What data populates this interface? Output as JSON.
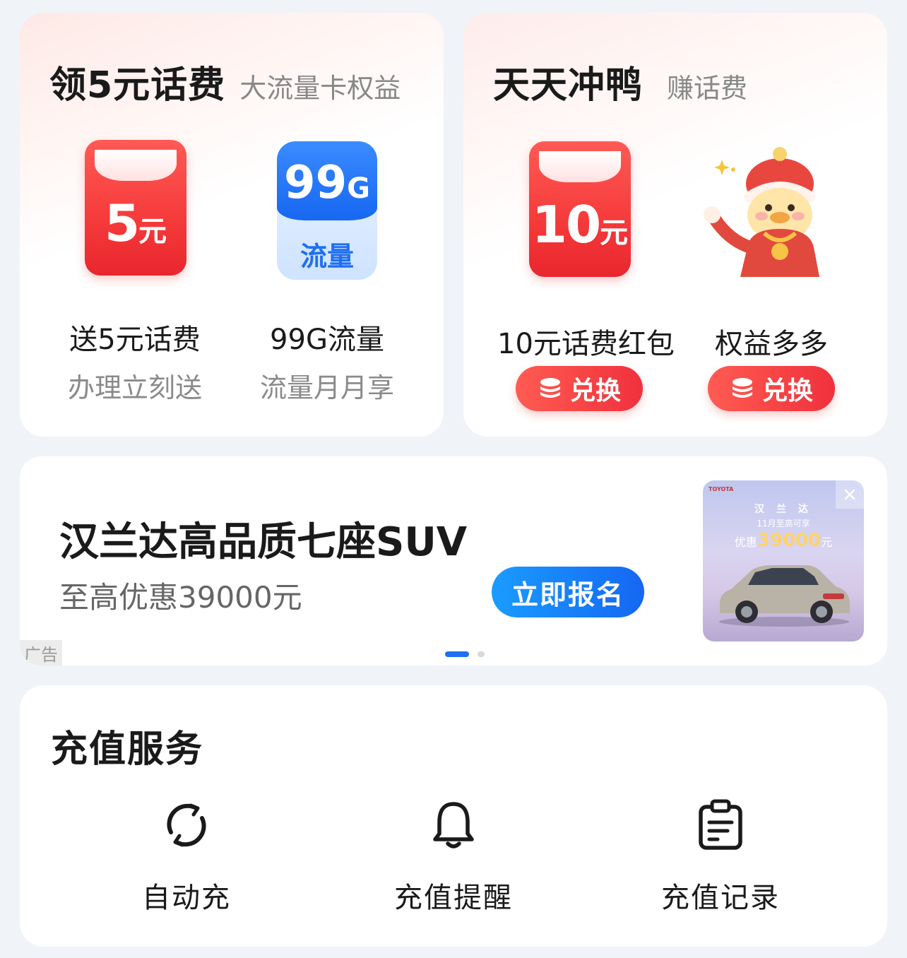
{
  "left_card": {
    "title": "领5元话费",
    "subtitle": "大流量卡权益",
    "items": [
      {
        "amount": "5",
        "unit": "元",
        "label": "送5元话费",
        "sub": "办理立刻送"
      },
      {
        "icon_num": "99",
        "icon_unit": "G",
        "icon_text": "流量",
        "label": "99G流量",
        "sub": "流量月月享"
      }
    ]
  },
  "right_card": {
    "title": "天天冲鸭",
    "subtitle": "赚话费",
    "items": [
      {
        "amount": "10",
        "unit": "元",
        "label": "10元话费红包",
        "button": "兑换"
      },
      {
        "label": "权益多多",
        "button": "兑换"
      }
    ]
  },
  "ad": {
    "title": "汉兰达高品质七座SUV",
    "subtitle": "至高优惠39000元",
    "button": "立即报名",
    "tag": "广告",
    "image": {
      "brand": "TOYOTA",
      "headline": "汉 兰 达",
      "month": "11月至高可享",
      "promo_prefix": "优惠",
      "promo_amount": "39000",
      "promo_unit": "元"
    },
    "carousel_active": 1,
    "carousel_total": 2
  },
  "service": {
    "title": "充值服务",
    "items": [
      {
        "label": "自动充",
        "icon": "auto-refresh-icon"
      },
      {
        "label": "充值提醒",
        "icon": "bell-icon"
      },
      {
        "label": "充值记录",
        "icon": "clipboard-icon"
      }
    ]
  },
  "colors": {
    "red": "#f53a3a",
    "blue": "#1f6ff0",
    "background": "#f0f3f8"
  }
}
